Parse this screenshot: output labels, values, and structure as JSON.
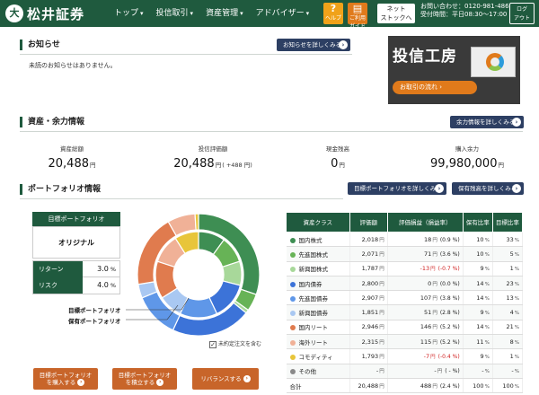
{
  "header": {
    "logo_mark": "大",
    "logo": "松井証券",
    "nav": [
      {
        "label": "トップ"
      },
      {
        "label": "投信取引"
      },
      {
        "label": "資産管理"
      },
      {
        "label": "アドバイザー"
      }
    ],
    "help_label": "ヘルプ",
    "guide_label": "ご利用ガイド",
    "guide_label_line1": "ご利用",
    "guide_label_line2": "ガイド",
    "netstock_label": "ネットストックへ",
    "netstock_line1": "ネット",
    "netstock_line2": "ストックへ",
    "contact_line1": "お問い合わせ：0120-981-486",
    "contact_line2": "受付時間：平日08:30～17:00",
    "logout_label": "ログアウト",
    "logout_line1": "ログ",
    "logout_line2": "アウト"
  },
  "notice": {
    "title": "お知らせ",
    "more_button": "お知らせを詳しくみる",
    "message": "未読のお知らせはありません。",
    "banner_title": "投信工房",
    "banner_cta": "お取引の流れ"
  },
  "assets": {
    "title": "資産・余力情報",
    "more_button": "余力情報を詳しくみる",
    "items": [
      {
        "label": "資産総額",
        "value": "20,488",
        "unit": "円",
        "extra": ""
      },
      {
        "label": "投信評価額",
        "value": "20,488",
        "unit": "円",
        "extra": "( +488 円)"
      },
      {
        "label": "現金残高",
        "value": "0",
        "unit": "円",
        "extra": ""
      },
      {
        "label": "購入余力",
        "value": "99,980,000",
        "unit": "円",
        "extra": ""
      }
    ]
  },
  "portfolio": {
    "title": "ポートフォリオ情報",
    "goal_button": "目標ポートフォリオを詳しくみる",
    "holding_button": "保有残高を詳しくみる",
    "target_label": "目標ポートフォリオ",
    "target_name": "オリジナル",
    "return_label": "リターン",
    "return_value": "3.0",
    "risk_label": "リスク",
    "risk_value": "4.0",
    "percent_unit": "%",
    "donut_label_target": "目標ポートフォリオ",
    "donut_label_holding": "保有ポートフォリオ",
    "include_unsettled": "未約定注文を含む",
    "include_unsettled_checked": true,
    "btn_buy_line1": "目標ポートフォリオ",
    "btn_buy_line2": "を購入する",
    "btn_set_line1": "目標ポートフォリオ",
    "btn_set_line2": "を積立する",
    "btn_rebalance": "リバランスする"
  },
  "table": {
    "headers": [
      "資産クラス",
      "評価額",
      "評価損益（損益率）",
      "保有比率",
      "目標比率"
    ],
    "rows": [
      {
        "cls": "国内株式",
        "color": "#3e8e53",
        "value": "2,018",
        "pl": "18",
        "plr": "(0.9 %)",
        "neg": false,
        "hold": "10",
        "target": "33"
      },
      {
        "cls": "先進国株式",
        "color": "#67b356",
        "value": "2,071",
        "pl": "71",
        "plr": "(3.6 %)",
        "neg": false,
        "hold": "10",
        "target": "5"
      },
      {
        "cls": "新興国株式",
        "color": "#a8d89a",
        "value": "1,787",
        "pl": "-13",
        "plr": "(-0.7 %)",
        "neg": true,
        "hold": "9",
        "target": "1"
      },
      {
        "cls": "国内債券",
        "color": "#3c73d8",
        "value": "2,800",
        "pl": "0",
        "plr": "(0.0 %)",
        "neg": false,
        "hold": "14",
        "target": "23"
      },
      {
        "cls": "先進国債券",
        "color": "#5f97e8",
        "value": "2,907",
        "pl": "107",
        "plr": "(3.8 %)",
        "neg": false,
        "hold": "14",
        "target": "13"
      },
      {
        "cls": "新興国債券",
        "color": "#a9c8f2",
        "value": "1,851",
        "pl": "51",
        "plr": "(2.8 %)",
        "neg": false,
        "hold": "9",
        "target": "4"
      },
      {
        "cls": "国内リート",
        "color": "#e07b4e",
        "value": "2,946",
        "pl": "146",
        "plr": "(5.2 %)",
        "neg": false,
        "hold": "14",
        "target": "21"
      },
      {
        "cls": "海外リート",
        "color": "#f0b197",
        "value": "2,315",
        "pl": "115",
        "plr": "(5.2 %)",
        "neg": false,
        "hold": "11",
        "target": "8"
      },
      {
        "cls": "コモディティ",
        "color": "#e8c53a",
        "value": "1,793",
        "pl": "-7",
        "plr": "(-0.4 %)",
        "neg": true,
        "hold": "9",
        "target": "1"
      },
      {
        "cls": "その他",
        "color": "#8a8a8a",
        "value": "-",
        "pl": "-",
        "plr": "( - %)",
        "neg": false,
        "hold": "-",
        "target": "-"
      },
      {
        "cls": "合計",
        "color": "",
        "value": "20,488",
        "pl": "488",
        "plr": "(2.4 %)",
        "neg": false,
        "hold": "100",
        "target": "100"
      }
    ]
  }
}
